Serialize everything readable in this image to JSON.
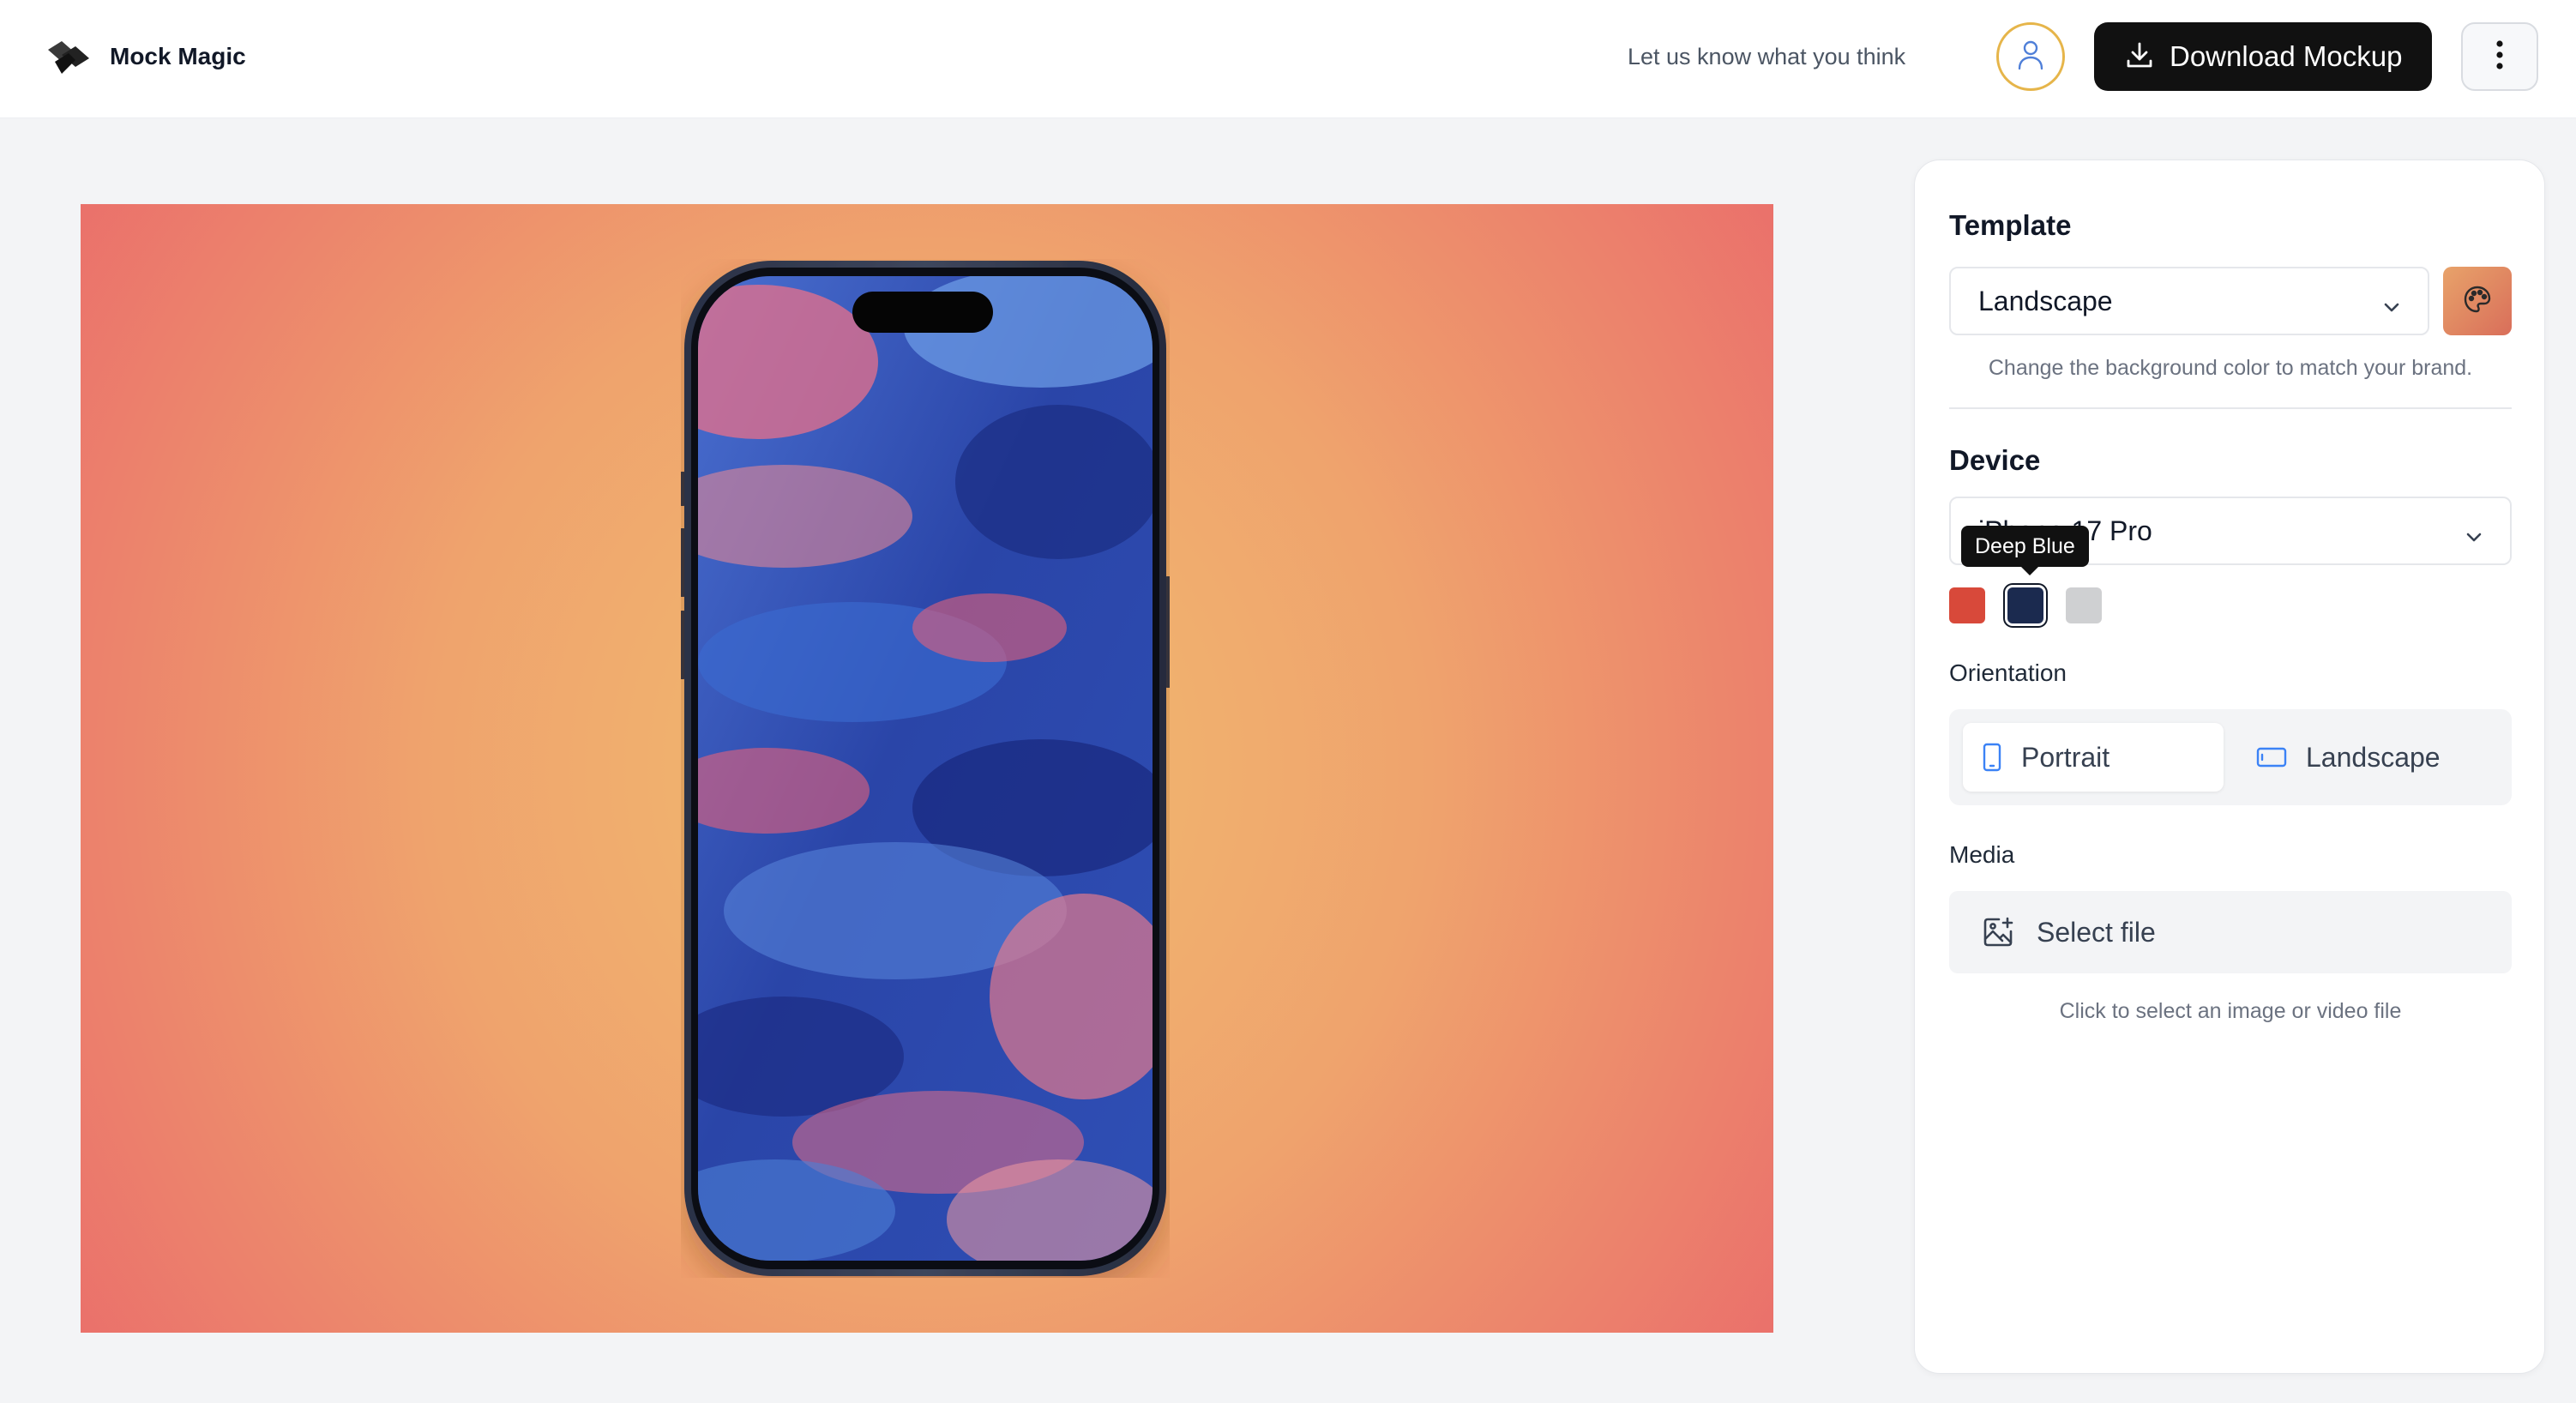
{
  "header": {
    "brand": "Mock Magic",
    "feedback": "Let us know what you think",
    "download_label": "Download Mockup",
    "icons": {
      "logo": "mock-magic-logo",
      "avatar": "user-icon",
      "download": "download-icon",
      "more": "more-vertical-icon"
    }
  },
  "canvas": {
    "background": {
      "center": "#f1bd70",
      "edge": "#ea6d6b"
    },
    "device_frame": "deep-blue",
    "screen_art": "abstract blue and pink oil painting"
  },
  "sidebar": {
    "template": {
      "title": "Template",
      "selected": "Landscape",
      "hint": "Change the background color to match your brand.",
      "color_button_icon": "palette-icon"
    },
    "device": {
      "title": "Device",
      "selected": "iPhone 17 Pro",
      "tooltip": "Deep Blue",
      "colors": [
        {
          "name": "Cosmic Orange",
          "hex": "#d8493a"
        },
        {
          "name": "Deep Blue",
          "hex": "#1b2a4f",
          "selected": true
        },
        {
          "name": "Silver",
          "hex": "#cfd0d2"
        }
      ]
    },
    "orientation": {
      "label": "Orientation",
      "options": [
        {
          "label": "Portrait",
          "icon": "phone-portrait-icon",
          "active": true
        },
        {
          "label": "Landscape",
          "icon": "phone-landscape-icon",
          "active": false
        }
      ]
    },
    "media": {
      "label": "Media",
      "button": "Select file",
      "icon": "image-plus-icon",
      "hint": "Click to select an image or video file"
    }
  }
}
